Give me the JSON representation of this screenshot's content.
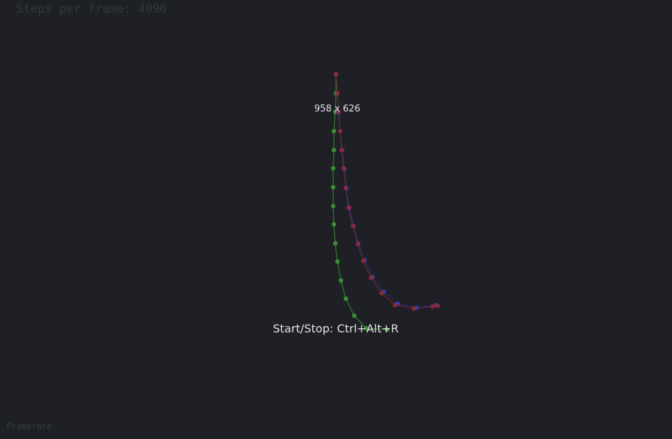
{
  "overlay": {
    "steps_per_frame": "Steps per frame: 4096",
    "framerate": "Framerate",
    "dimensions": "958 x 626",
    "shortcut_hint": "Start/Stop: Ctrl+Alt+R"
  },
  "colors": {
    "background": "#1e2026",
    "green_path": "#2f7d2c",
    "green_node": "#3a8f35",
    "red_path": "#7a2840",
    "red_node": "#8a2a3a",
    "blue_node": "#3b3fc0",
    "text": "#e4e4e4"
  }
}
